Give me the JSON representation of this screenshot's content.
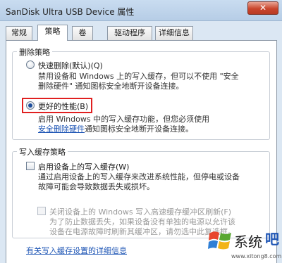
{
  "window": {
    "title": "SanDisk Ultra USB Device 属性",
    "close_label": "✕"
  },
  "tabs": [
    {
      "label": "常规"
    },
    {
      "label": "策略"
    },
    {
      "label": "卷"
    },
    {
      "label": "驱动程序"
    },
    {
      "label": "详细信息"
    }
  ],
  "removal_policy": {
    "title": "删除策略",
    "quick_removal": {
      "label": "快速删除(默认)(Q)",
      "desc_line1": "禁用设备和 Windows 上的写入缓存，但可以不使用 \"安全",
      "desc_line2": "删除硬件\" 通知图标安全地断开设备连接。"
    },
    "better_performance": {
      "label": "更好的性能(B)",
      "desc_line1": "启用 Windows 中的写入缓存功能，但您必须使用",
      "desc_link": "安全删除硬件",
      "desc_line2_rest": "通知图标安全地断开设备连接。"
    }
  },
  "write_cache_policy": {
    "title": "写入缓存策略",
    "enable_cache": {
      "label": "启用设备上的写入缓存(W)",
      "desc_line1": "通过启用设备上的写入缓存来改进系统性能，但停电或设备",
      "desc_line2": "故障可能会导致数据丢失或损坏。"
    },
    "disable_flush": {
      "label": "关闭设备上的 Windows 写入高速缓存缓冲区刷新(F)",
      "desc_line1": "为了防止数据丢失，如果设备没有单独的电源以允许该",
      "desc_line2": "设备在电源故障时刷新其缓冲区，请勿选中此复选框。"
    }
  },
  "details_link": "有关写入缓存设置的详细信息",
  "watermark": {
    "brand": "系统",
    "brand_tail": "吧",
    "url": "www.xitong8.com"
  }
}
